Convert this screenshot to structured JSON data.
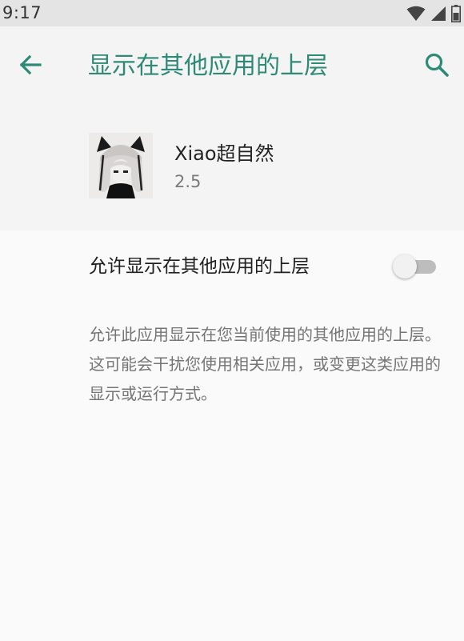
{
  "status_bar": {
    "time": "9:17",
    "icons": [
      "wifi-icon",
      "signal-icon",
      "battery-icon"
    ]
  },
  "app_bar": {
    "title": "显示在其他应用的上层",
    "back_icon": "arrow-back-icon",
    "search_icon": "search-icon"
  },
  "app_info": {
    "name": "Xiao超自然",
    "version": "2.5"
  },
  "permission": {
    "label": "允许显示在其他应用的上层",
    "enabled": false
  },
  "description": "允许此应用显示在您当前使用的其他应用的上层。这可能会干扰您使用相关应用，或变更这类应用的显示或运行方式。",
  "colors": {
    "accent": "#2e8a77",
    "status_bar_bg": "#e4e4e4",
    "header_bg": "#f4f4f4",
    "body_bg": "#fafafa",
    "toggle_track_off": "#bdbdbd"
  }
}
